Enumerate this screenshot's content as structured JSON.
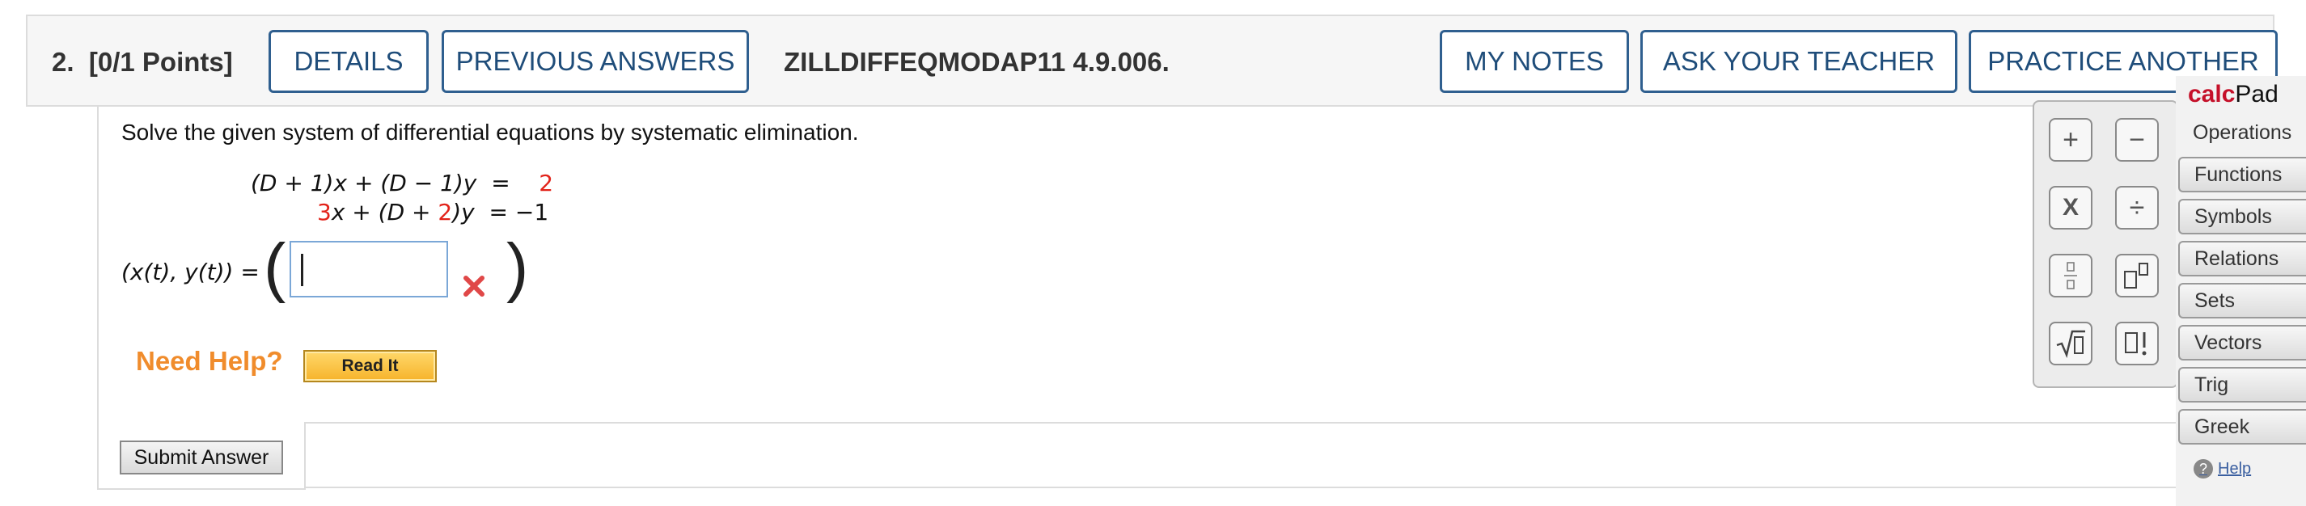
{
  "header": {
    "question_number": "2.",
    "points": "[0/1 Points]",
    "details_label": "DETAILS",
    "previous_answers_label": "PREVIOUS ANSWERS",
    "question_code": "ZILLDIFFEQMODAP11 4.9.006.",
    "my_notes_label": "MY NOTES",
    "ask_teacher_label": "ASK YOUR TEACHER",
    "practice_another_label": "PRACTICE ANOTHER"
  },
  "question": {
    "prompt": "Solve the given system of differential equations by systematic elimination.",
    "eq1": {
      "lhs": "(D + 1)x + (D − 1)y",
      "eq": "=",
      "rhs": "2"
    },
    "eq2": {
      "coef": "3",
      "rest1": "x + (D + ",
      "two": "2",
      "rest2": ")y",
      "eq": "=",
      "rhs": "−1"
    },
    "answer_label": "(x(t), y(t)) =",
    "answer_value": "",
    "answer_status": "incorrect"
  },
  "help": {
    "need_help_label": "Need Help?",
    "read_it_label": "Read It"
  },
  "submit_label": "Submit Answer",
  "calcpad": {
    "title_bold": "calc",
    "title_rest": "Pad",
    "buttons": [
      "+",
      "−",
      "X",
      "÷",
      "fraction",
      "superscript",
      "sqrt",
      "factorial"
    ],
    "menu": [
      "Operations",
      "Functions",
      "Symbols",
      "Relations",
      "Sets",
      "Vectors",
      "Trig",
      "Greek"
    ],
    "active_menu": "Operations",
    "help_label": "Help"
  },
  "colors": {
    "button_border": "#2f5f8f",
    "button_text": "#1f4d7a",
    "highlight_red": "#e2231a",
    "need_help_orange": "#f08c2c",
    "calcpad_red": "#c5112a"
  }
}
